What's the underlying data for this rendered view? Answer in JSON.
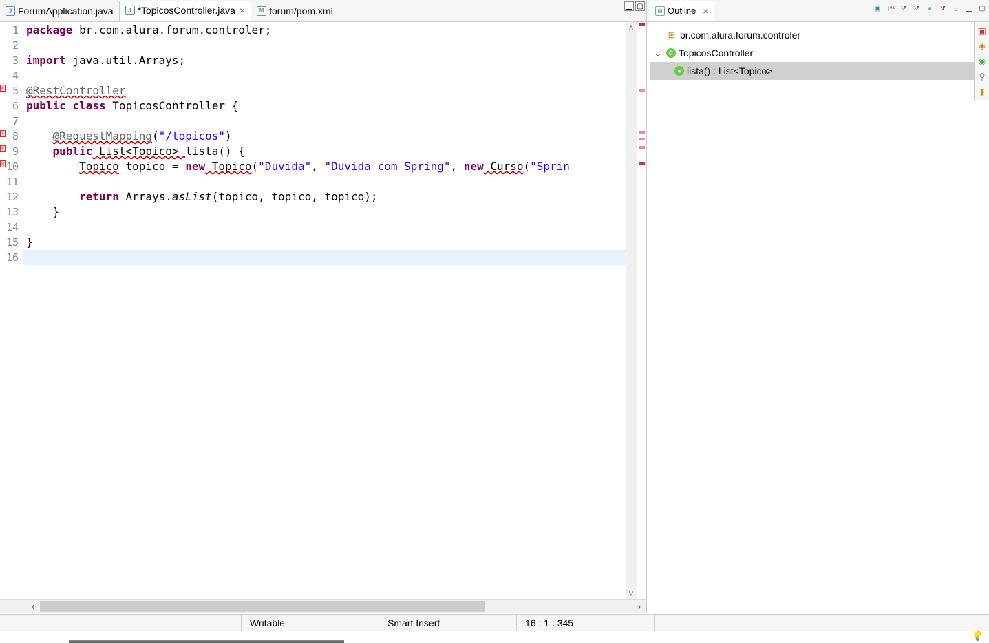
{
  "tabs": [
    {
      "label": "ForumApplication.java",
      "icon": "J",
      "active": false,
      "dirty": false
    },
    {
      "label": "*TopicosController.java",
      "icon": "J",
      "active": true,
      "dirty": true
    },
    {
      "label": "forum/pom.xml",
      "icon": "M",
      "active": false,
      "dirty": false
    }
  ],
  "code_lines": [
    "1",
    "2",
    "3",
    "4",
    "5",
    "6",
    "7",
    "8",
    "9",
    "10",
    "11",
    "12",
    "13",
    "14",
    "15",
    "16"
  ],
  "code": {
    "l1": {
      "kw1": "package",
      "pkg": " br.com.alura.forum.controler;"
    },
    "l3": {
      "kw1": "import",
      "pkg": " java.util.Arrays;"
    },
    "l5": {
      "ann": "@RestController"
    },
    "l6": {
      "kw1": "public",
      "kw2": "class",
      "name": " TopicosController {"
    },
    "l8": {
      "indent": "    ",
      "ann": "@RequestMapping",
      "paren": "(",
      "str": "\"/topicos\"",
      "close": ")"
    },
    "l9": {
      "indent": "    ",
      "kw1": "public",
      "type": " List<Topico> ",
      "method": "lista() {"
    },
    "l10": {
      "indent": "        ",
      "type1": "Topico",
      "var": " topico = ",
      "kw1": "new",
      "type2": " Topico",
      "paren": "(",
      "str1": "\"Duvida\"",
      "comma1": ", ",
      "str2": "\"Duvida com Spring\"",
      "comma2": ", ",
      "kw2": "new",
      "type3": " Curso",
      "paren2": "(",
      "str3": "\"Sprin"
    },
    "l12": {
      "indent": "        ",
      "kw1": "return",
      "sp": " Arrays.",
      "method": "asList",
      "args": "(topico, topico, topico);"
    },
    "l13": {
      "indent": "    }",
      "txt": ""
    },
    "l15": {
      "txt": "}"
    }
  },
  "outline": {
    "title": "Outline",
    "package": "br.com.alura.forum.controler",
    "class": "TopicosController",
    "method": "lista() : List<Topico>"
  },
  "status": {
    "writable": "Writable",
    "insert": "Smart Insert",
    "position": "16 : 1 : 345"
  }
}
